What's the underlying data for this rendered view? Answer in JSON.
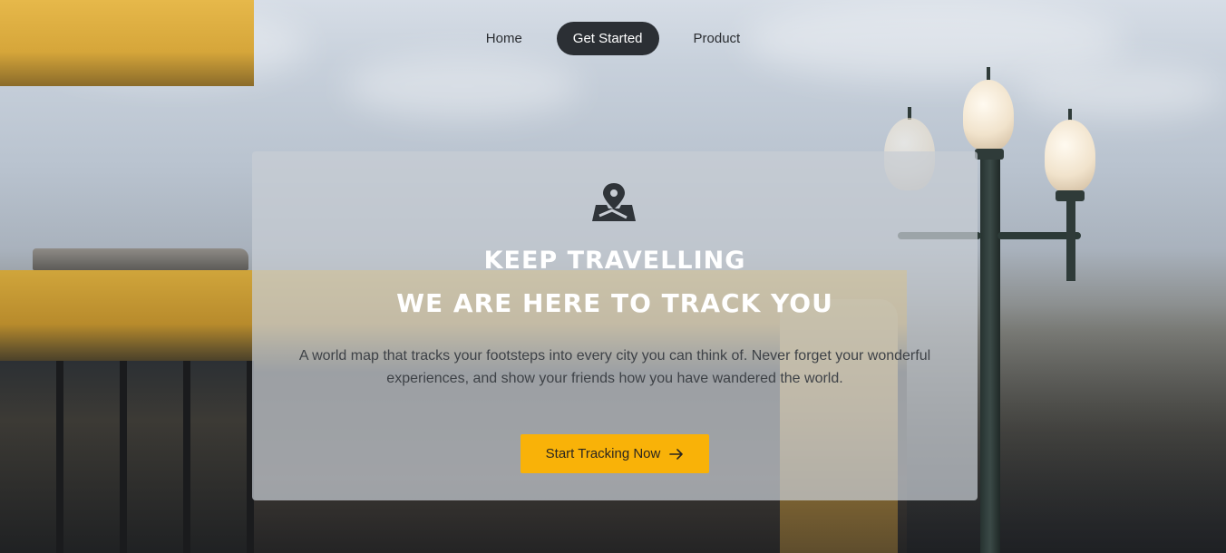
{
  "nav": {
    "items": [
      {
        "label": "Home",
        "active": false
      },
      {
        "label": "Get Started",
        "active": true
      },
      {
        "label": "Product",
        "active": false
      }
    ]
  },
  "hero": {
    "icon": "map-pin-icon",
    "title_line1": "KEEP TRAVELLING",
    "title_line2": "WE ARE HERE TO TRACK YOU",
    "description": "A world map that tracks your footsteps into every city you can think of. Never forget your wonderful experiences, and show your friends how you have wandered the world.",
    "cta_label": "Start Tracking Now",
    "cta_icon": "arrow-right-icon"
  },
  "colors": {
    "accent": "#f9b208",
    "nav_active_bg": "#2b2f34",
    "card_bg": "#c8cdd4"
  }
}
